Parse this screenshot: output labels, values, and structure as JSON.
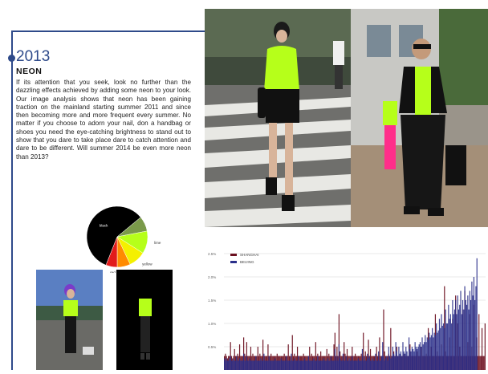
{
  "page": {
    "year": "2013",
    "section_title": "NEON",
    "body": "If its attention that you seek, look no further than the dazzling effects achieved by adding some neon to your look. Our image analysis shows that neon has been gaining traction on the mainland starting summer 2011 and since then becoming more and more frequent every summer. No matter if you choose to adorn your nail, don a handbag or shoes you need the eye-catching brightness to stand out to show that you dare to take place dare to catch attention and dare to be different. Will summer 2014 be even more neon than 2013?"
  },
  "colors": {
    "accent": "#2e4a8a",
    "neon": "#b6ff1a",
    "shanghai": "#6b1020",
    "beijing": "#2a2f8a"
  },
  "photos": [
    {
      "name": "street-photo-woman-neon-top"
    },
    {
      "name": "street-photo-man-neon-top"
    },
    {
      "name": "photo-woman-purple-hair-neon"
    },
    {
      "name": "cutout-neon-outfit"
    }
  ],
  "chart_data": [
    {
      "type": "pie",
      "labels": [
        "black",
        "lime",
        "yellow",
        "orange",
        "red"
      ],
      "values": [
        58,
        12,
        9,
        7,
        6,
        8
      ],
      "colors": [
        "#000000",
        "#b6ff1a",
        "#f4f000",
        "#ff8a00",
        "#e21b1b",
        "#7a9a4a"
      ],
      "slice_labels": [
        "black",
        "lime",
        "yellow",
        "orange",
        "red"
      ]
    },
    {
      "type": "bar",
      "legend": [
        "SHANGHAI",
        "BEIJING"
      ],
      "ylim": [
        0,
        2.5
      ],
      "ytick_labels": [
        "2.5%",
        "2.0%",
        "1.5%",
        "1.0%",
        "0.5%"
      ],
      "yticks": [
        2.5,
        2.0,
        1.5,
        1.0,
        0.5
      ],
      "series": [
        {
          "name": "SHANGHAI",
          "values": [
            0.3,
            0.35,
            0.3,
            0.25,
            0.3,
            0.3,
            0.6,
            0.3,
            0.25,
            0.3,
            0.45,
            0.3,
            0.3,
            0.35,
            0.3,
            0.55,
            0.3,
            0.3,
            0.3,
            0.7,
            0.35,
            0.3,
            0.6,
            0.3,
            0.3,
            0.3,
            0.5,
            0.3,
            0.35,
            0.3,
            0.3,
            0.3,
            0.3,
            0.5,
            0.3,
            0.35,
            0.3,
            0.3,
            0.65,
            0.3,
            0.3,
            0.3,
            0.3,
            0.55,
            0.3,
            0.3,
            0.35,
            0.3,
            0.3,
            0.3,
            0.3,
            0.3,
            0.35,
            0.3,
            0.3,
            0.3,
            0.3,
            0.3,
            0.3,
            0.35,
            0.3,
            0.3,
            0.3,
            0.55,
            0.3,
            0.3,
            0.3,
            0.75,
            0.3,
            0.35,
            0.3,
            0.3,
            0.5,
            0.3,
            0.3,
            0.3,
            0.3,
            0.3,
            0.35,
            0.3,
            0.3,
            0.3,
            0.3,
            0.3,
            0.5,
            0.3,
            0.35,
            0.3,
            0.3,
            0.3,
            0.6,
            0.3,
            0.35,
            0.3,
            0.3,
            0.4,
            0.3,
            0.3,
            0.3,
            0.3,
            0.3,
            0.45,
            0.3,
            0.35,
            0.3,
            0.3,
            0.3,
            0.3,
            0.55,
            0.8,
            0.3,
            0.5,
            0.3,
            1.2,
            0.4,
            0.3,
            0.3,
            0.3,
            0.6,
            0.35,
            0.3,
            0.45,
            0.3,
            0.3,
            0.3,
            0.3,
            0.5,
            0.3,
            0.3,
            0.35,
            0.3,
            0.3,
            0.3,
            0.3,
            0.3,
            0.35,
            0.3,
            0.8,
            0.3,
            0.4,
            0.3,
            0.3,
            0.65,
            0.3,
            0.45,
            0.3,
            0.3,
            0.3,
            0.3,
            0.3,
            0.5,
            0.3,
            0.3,
            0.7,
            0.3,
            0.3,
            0.3,
            1.3,
            0.4,
            0.3,
            0.3,
            0.3,
            0.35,
            0.3,
            0.9,
            0.3,
            0.3,
            0.4,
            0.3,
            0.3,
            0.5,
            0.3,
            0.3,
            0.3,
            0.3,
            0.3,
            0.3,
            0.35,
            0.3,
            0.3,
            0.3,
            0.3,
            0.3,
            0.55,
            0.3,
            0.3,
            0.3,
            0.3,
            0.3,
            0.3,
            0.4,
            0.3,
            0.3,
            0.3,
            0.5,
            0.3,
            0.3,
            0.3,
            0.3,
            0.35,
            0.3,
            0.9,
            0.3,
            0.3,
            0.5,
            0.3,
            0.3,
            0.3,
            1.2,
            0.3,
            0.4,
            0.3,
            0.3,
            0.3,
            0.55,
            0.3,
            0.3,
            1.8,
            0.4,
            0.3,
            0.3,
            0.3,
            0.7,
            0.3,
            0.3,
            1.1,
            0.3,
            0.3,
            1.6,
            0.3,
            1.0,
            0.3,
            0.5,
            0.3,
            0.3,
            1.3,
            0.3,
            1.7,
            0.3,
            0.3,
            0.6,
            0.3,
            1.2,
            0.3,
            0.5,
            0.3,
            1.4,
            0.3,
            0.3,
            0.7,
            0.3,
            1.2,
            0.3,
            0.3,
            0.9,
            0.3,
            0.3,
            1.0
          ]
        },
        {
          "name": "BEIJING",
          "values": [
            0.25,
            0.2,
            0.25,
            0.2,
            0.2,
            0.25,
            0.3,
            0.2,
            0.2,
            0.25,
            0.2,
            0.2,
            0.3,
            0.2,
            0.2,
            0.25,
            0.2,
            0.2,
            0.2,
            0.35,
            0.2,
            0.2,
            0.3,
            0.2,
            0.2,
            0.25,
            0.2,
            0.2,
            0.2,
            0.2,
            0.2,
            0.3,
            0.2,
            0.2,
            0.2,
            0.2,
            0.25,
            0.2,
            0.2,
            0.35,
            0.2,
            0.2,
            0.2,
            0.2,
            0.3,
            0.2,
            0.2,
            0.2,
            0.2,
            0.2,
            0.25,
            0.2,
            0.2,
            0.2,
            0.2,
            0.2,
            0.25,
            0.2,
            0.2,
            0.2,
            0.2,
            0.3,
            0.2,
            0.2,
            0.2,
            0.2,
            0.35,
            0.2,
            0.2,
            0.25,
            0.2,
            0.2,
            0.2,
            0.3,
            0.2,
            0.2,
            0.2,
            0.2,
            0.2,
            0.25,
            0.2,
            0.2,
            0.2,
            0.3,
            0.2,
            0.2,
            0.2,
            0.2,
            0.25,
            0.2,
            0.2,
            0.2,
            0.3,
            0.2,
            0.2,
            0.2,
            0.2,
            0.2,
            0.25,
            0.2,
            0.2,
            0.2,
            0.25,
            0.2,
            0.2,
            0.3,
            0.2,
            0.2,
            0.2,
            0.45,
            0.2,
            0.3,
            0.2,
            0.55,
            0.25,
            0.2,
            0.2,
            0.35,
            0.2,
            0.2,
            0.3,
            0.2,
            0.2,
            0.25,
            0.2,
            0.2,
            0.3,
            0.2,
            0.2,
            0.2,
            0.2,
            0.2,
            0.25,
            0.2,
            0.2,
            0.2,
            0.45,
            0.2,
            0.3,
            0.2,
            0.2,
            0.35,
            0.25,
            0.3,
            0.2,
            0.2,
            0.25,
            0.2,
            0.2,
            0.35,
            0.2,
            0.2,
            0.4,
            0.2,
            0.2,
            0.3,
            0.6,
            0.3,
            0.2,
            0.25,
            0.3,
            0.2,
            0.5,
            0.3,
            0.25,
            0.3,
            0.5,
            0.35,
            0.3,
            0.6,
            0.4,
            0.3,
            0.5,
            0.35,
            0.4,
            0.3,
            0.6,
            0.4,
            0.35,
            0.5,
            0.4,
            0.3,
            0.7,
            0.45,
            0.4,
            0.5,
            0.45,
            0.4,
            0.6,
            0.5,
            0.45,
            0.5,
            0.55,
            0.6,
            0.5,
            0.7,
            0.55,
            0.6,
            0.75,
            0.6,
            0.7,
            0.65,
            0.8,
            0.7,
            0.75,
            0.9,
            0.7,
            0.8,
            0.75,
            1.0,
            0.8,
            0.85,
            1.1,
            0.9,
            1.2,
            0.95,
            1.0,
            0.9,
            1.3,
            1.0,
            1.0,
            1.4,
            1.1,
            1.2,
            1.0,
            1.5,
            1.2,
            1.3,
            1.5,
            1.2,
            1.6,
            1.3,
            1.4,
            1.7,
            1.2,
            1.5,
            1.3,
            1.8,
            1.5,
            1.4,
            1.6,
            1.3,
            1.7,
            1.5,
            1.9,
            1.6,
            2.0,
            1.5,
            1.8,
            2.4
          ]
        }
      ]
    }
  ]
}
